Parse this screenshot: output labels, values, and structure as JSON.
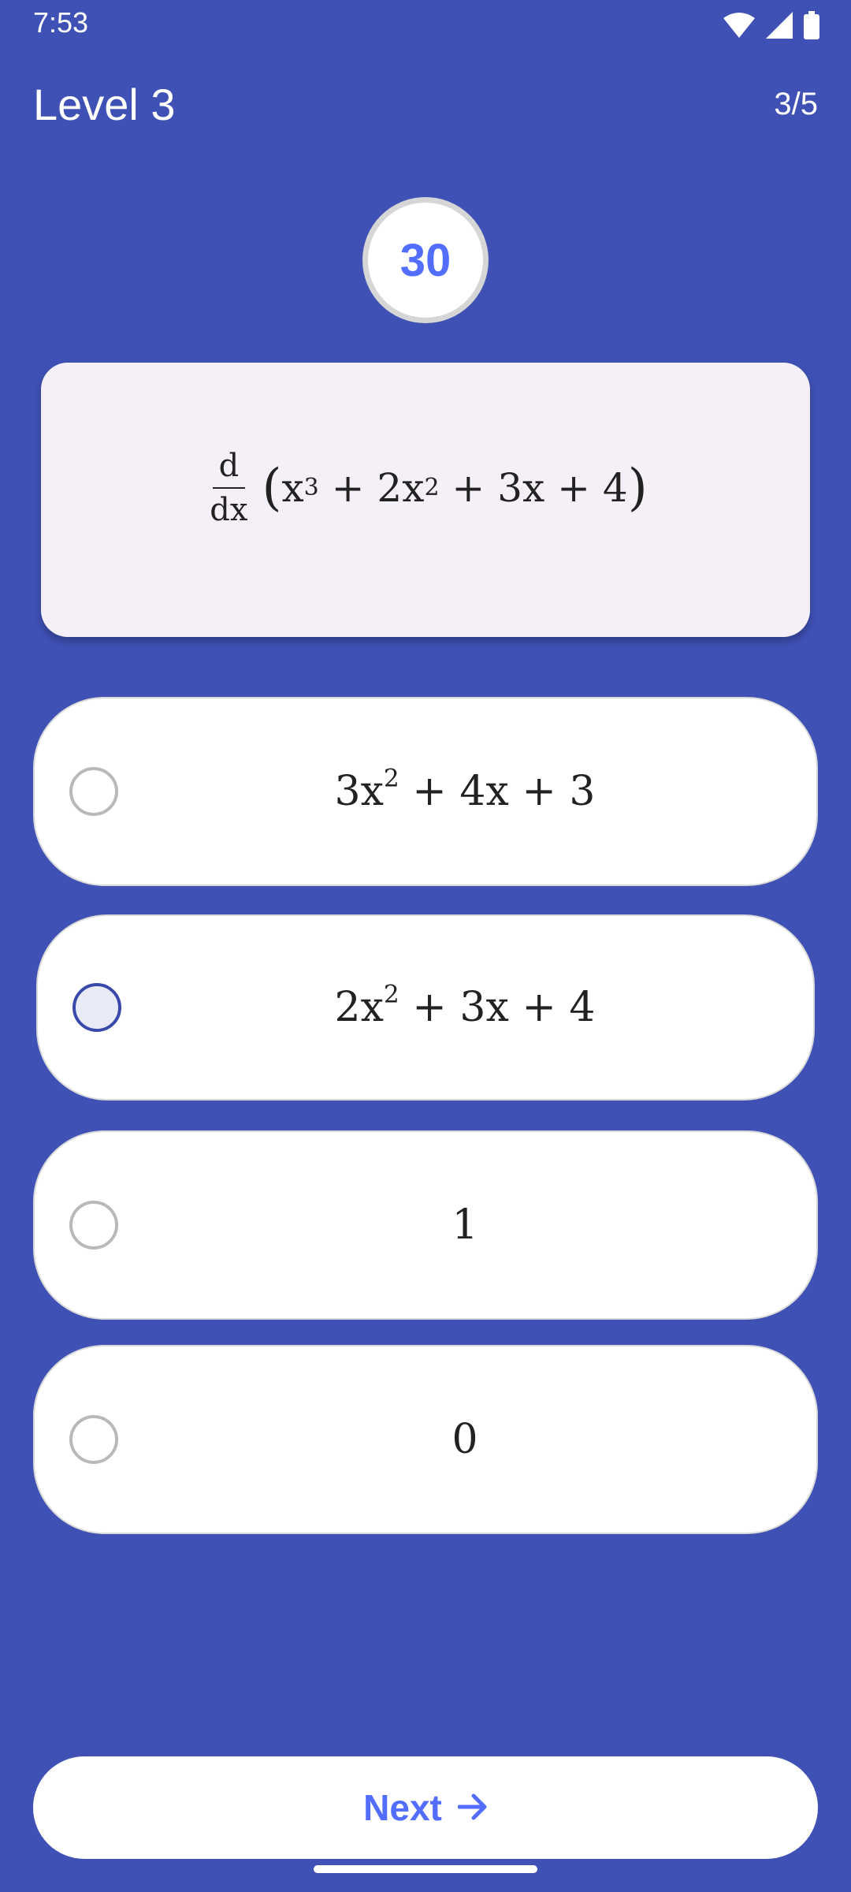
{
  "colors": {
    "background": "#3f51b5",
    "accent": "#536dfe",
    "card": "#f5f0f8",
    "selected_radio": "#3949ab"
  },
  "status_bar": {
    "time": "7:53",
    "icons": [
      "wifi-icon",
      "signal-icon",
      "battery-icon"
    ]
  },
  "header": {
    "level_title": "Level 3",
    "progress": "3/5"
  },
  "timer": {
    "value": "30"
  },
  "question": {
    "fraction_numerator": "d",
    "fraction_denominator": "dx",
    "expression_parts": [
      "x",
      "3",
      " + 2x",
      "2",
      " + 3x + 4"
    ]
  },
  "options": [
    {
      "parts": [
        "3x",
        "2",
        " + 4x + 3"
      ],
      "selected": false
    },
    {
      "parts": [
        "2x",
        "2",
        " + 3x + 4"
      ],
      "selected": true
    },
    {
      "text": "1",
      "selected": false
    },
    {
      "text": "0",
      "selected": false
    }
  ],
  "footer": {
    "next_label": "Next",
    "next_icon": "arrow-right-icon"
  }
}
